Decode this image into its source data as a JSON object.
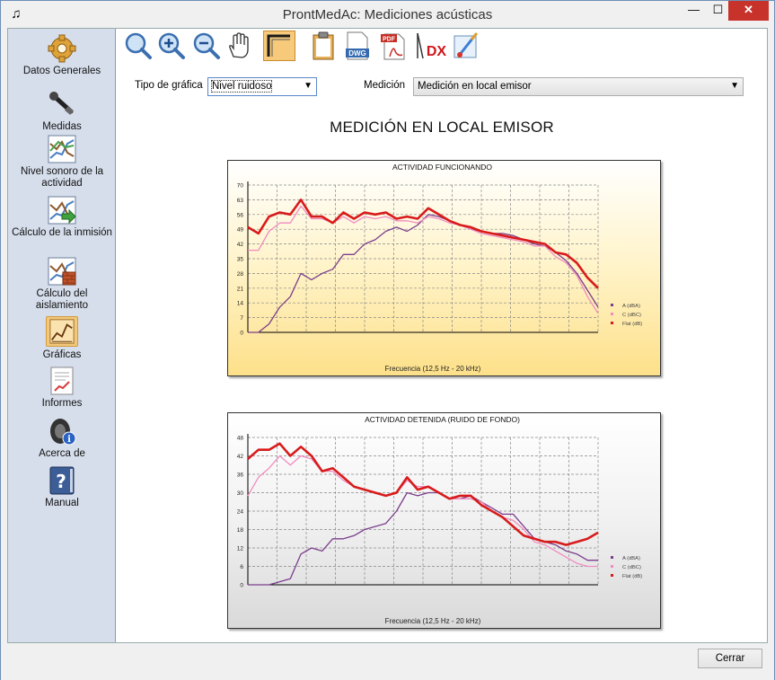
{
  "window": {
    "title": "ProntMedAc: Mediciones acústicas"
  },
  "sidebar": {
    "items": [
      {
        "label": "Datos Generales",
        "icon": "gear-icon"
      },
      {
        "label": "Medidas",
        "icon": "microphone-icon"
      },
      {
        "label": "Nivel sonoro de la actividad",
        "icon": "chart-icon"
      },
      {
        "label": "Cálculo de la inmisión",
        "icon": "chart-arrow-icon"
      },
      {
        "label": "Cálculo del aislamiento",
        "icon": "chart-wall-icon"
      },
      {
        "label": "Gráficas",
        "icon": "graphs-icon"
      },
      {
        "label": "Informes",
        "icon": "report-icon"
      },
      {
        "label": "Acerca de",
        "icon": "speaker-info-icon"
      },
      {
        "label": "Manual",
        "icon": "help-book-icon"
      }
    ],
    "active": "Gráficas"
  },
  "toolbar": {
    "tools": [
      "zoom-icon",
      "zoom-in-icon",
      "zoom-out-icon",
      "pan-hand-icon",
      "frame-icon",
      "clipboard-icon",
      "dwg-icon",
      "pdf-icon",
      "dxf-icon",
      "image-edit-icon"
    ],
    "dwg": "DWG",
    "pdf": "PDF",
    "dxf": "DX"
  },
  "filters": {
    "tipo_label": "Tipo de gráfica",
    "tipo_value": "Nivel ruidoso",
    "medicion_label": "Medición",
    "medicion_value": "Medición en local emisor"
  },
  "page_title": "MEDICIÓN EN LOCAL EMISOR",
  "close_button": "Cerrar",
  "chart_data": [
    {
      "type": "line",
      "title": "ACTIVIDAD FUNCIONANDO",
      "xlabel": "Frecuencia (12,5 Hz - 20 kHz)",
      "ylabel": "",
      "ylim": [
        0,
        70
      ],
      "yticks": [
        0,
        7,
        14,
        21,
        28,
        35,
        42,
        49,
        56,
        63,
        70
      ],
      "grid": true,
      "legend": "right",
      "series": [
        {
          "name": "A (dBA)",
          "color": "#7b3f8c",
          "values": [
            0,
            0,
            4,
            12,
            17,
            28,
            25,
            28,
            30,
            37,
            37,
            42,
            44,
            48,
            50,
            48,
            51,
            56,
            55,
            53,
            51,
            49,
            48,
            47,
            47,
            46,
            44,
            42,
            41,
            38,
            34,
            28,
            20,
            12
          ]
        },
        {
          "name": "C (dBC)",
          "color": "#f08cbf",
          "values": [
            39,
            39,
            48,
            52,
            52,
            60,
            54,
            54,
            52,
            55,
            52,
            55,
            54,
            55,
            53,
            53,
            52,
            55,
            54,
            52,
            51,
            49,
            47,
            46,
            45,
            44,
            43,
            41,
            41,
            36,
            33,
            27,
            17,
            9
          ]
        },
        {
          "name": "Flat (dB)",
          "color": "#d81b1b",
          "values": [
            50,
            47,
            55,
            57,
            56,
            63,
            55,
            55,
            52,
            57,
            54,
            57,
            56,
            57,
            54,
            55,
            54,
            59,
            56,
            53,
            51,
            50,
            48,
            47,
            46,
            45,
            44,
            43,
            42,
            38,
            37,
            33,
            26,
            21
          ]
        }
      ]
    },
    {
      "type": "line",
      "title": "ACTIVIDAD DETENIDA (RUIDO DE FONDO)",
      "xlabel": "Frecuencia (12,5 Hz - 20 kHz)",
      "ylabel": "",
      "ylim": [
        0,
        48
      ],
      "yticks": [
        0,
        6,
        12,
        18,
        24,
        30,
        36,
        42,
        48
      ],
      "grid": true,
      "legend": "right",
      "series": [
        {
          "name": "A (dBA)",
          "color": "#7b3f8c",
          "values": [
            0,
            0,
            0,
            1,
            2,
            10,
            12,
            11,
            15,
            15,
            16,
            18,
            19,
            20,
            24,
            30,
            29,
            30,
            30,
            28,
            28,
            29,
            27,
            25,
            23,
            23,
            19,
            15,
            14,
            13,
            11,
            10,
            8,
            8
          ]
        },
        {
          "name": "C (dBC)",
          "color": "#f08cbf",
          "values": [
            29,
            35,
            38,
            42,
            39,
            42,
            41,
            37,
            37,
            34,
            32,
            31,
            30,
            29,
            30,
            34,
            32,
            32,
            30,
            28,
            28,
            28,
            27,
            24,
            22,
            21,
            18,
            14,
            13,
            11,
            9,
            7,
            6,
            6
          ]
        },
        {
          "name": "Flat (dB)",
          "color": "#d81b1b",
          "values": [
            41,
            44,
            44,
            46,
            42,
            45,
            42,
            37,
            38,
            35,
            32,
            31,
            30,
            29,
            30,
            35,
            31,
            32,
            30,
            28,
            29,
            29,
            26,
            24,
            22,
            19,
            16,
            15,
            14,
            14,
            13,
            14,
            15,
            17
          ]
        }
      ]
    }
  ]
}
